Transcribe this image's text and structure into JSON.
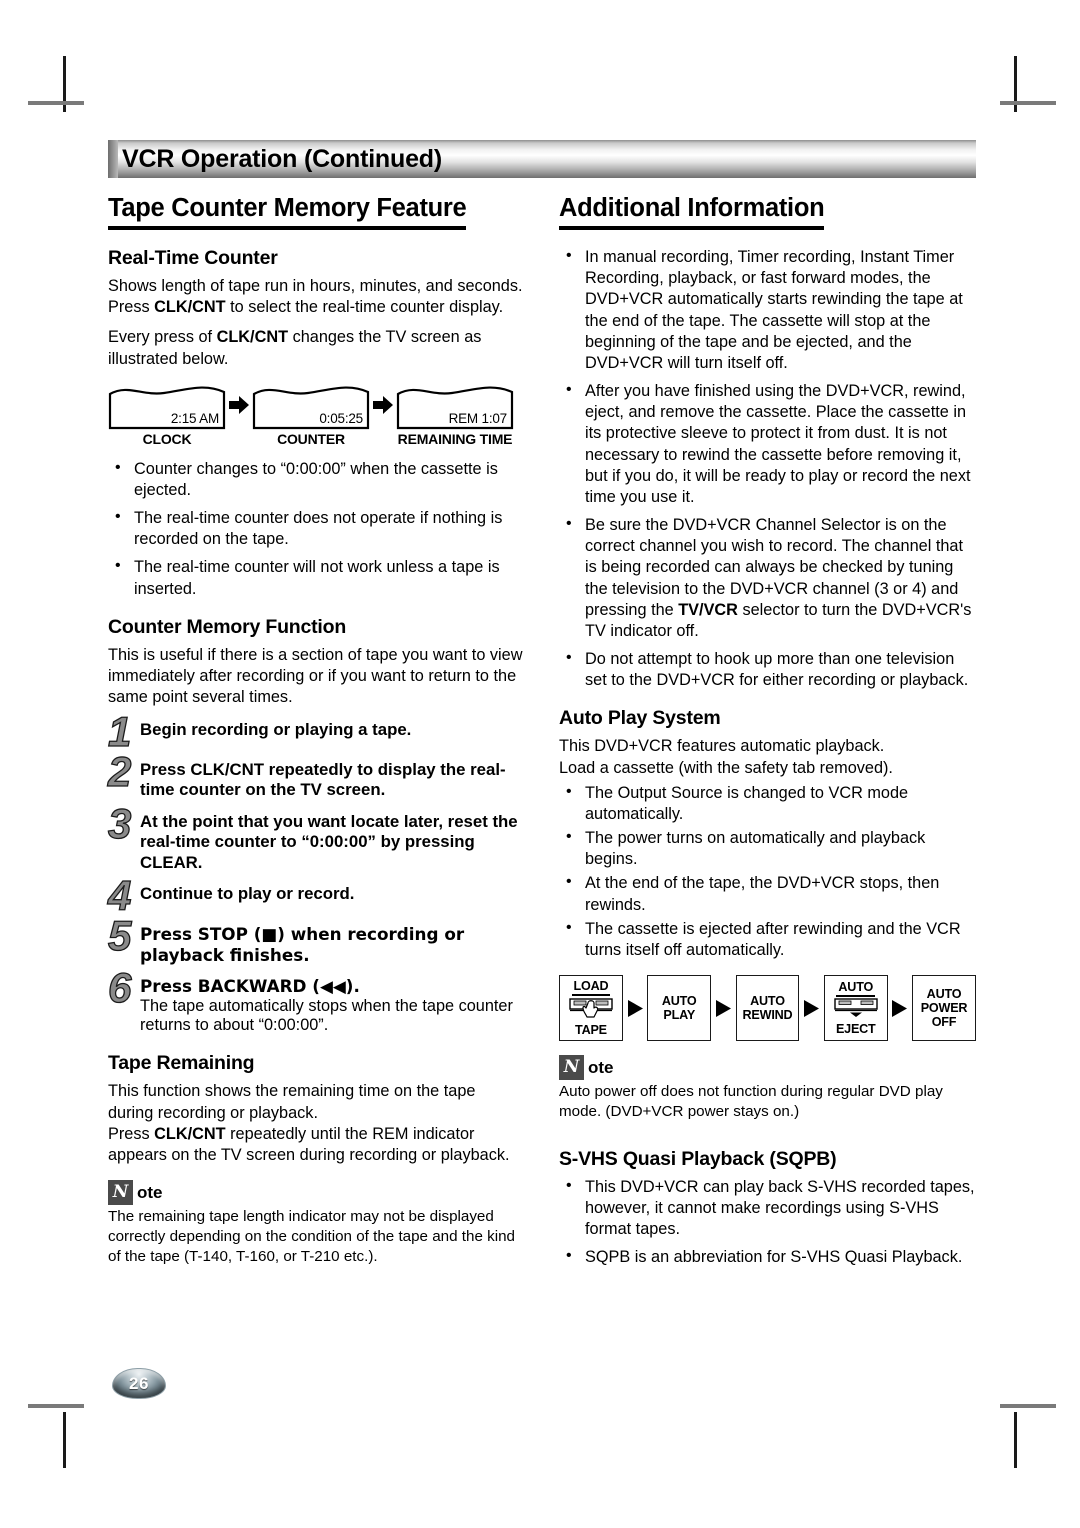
{
  "chapter": {
    "title": "VCR Operation (Continued)"
  },
  "page": {
    "number": "26"
  },
  "left": {
    "section_title": "Tape Counter Memory Feature",
    "realtime": {
      "heading": "Real-Time Counter",
      "para1_a": "Shows length of tape run in hours, minutes, and seconds. Press ",
      "para1_b": "CLK/CNT",
      "para1_c": " to select the real-time counter display.",
      "para2_a": "Every press of ",
      "para2_b": "CLK/CNT",
      "para2_c": " changes the TV screen as illustrated below."
    },
    "screens": [
      {
        "value": "2:15 AM",
        "label": "CLOCK"
      },
      {
        "value": "0:05:25",
        "label": "COUNTER"
      },
      {
        "value": "REM 1:07",
        "label": "REMAINING TIME"
      }
    ],
    "realtime_bullets": [
      "Counter changes to “0:00:00” when the cassette is ejected.",
      "The real-time counter does not operate if nothing is recorded on the tape.",
      "The real-time counter will not work unless a tape is inserted."
    ],
    "memory": {
      "heading": "Counter Memory Function",
      "intro": "This is useful if there is a section of tape you want to view immediately after recording or if you want to return to the same point several times."
    },
    "steps": [
      {
        "num": "1",
        "text": "Begin recording or playing a tape.",
        "extra": ""
      },
      {
        "num": "2",
        "text": "Press CLK/CNT repeatedly to display the real-time counter on the TV screen.",
        "extra": ""
      },
      {
        "num": "3",
        "text": "At the point that you want locate later, reset the real-time counter to “0:00:00” by pressing CLEAR.",
        "extra": ""
      },
      {
        "num": "4",
        "text": "Continue to play or record.",
        "extra": ""
      },
      {
        "num": "5",
        "text": "Press STOP (■) when recording or playback finishes.",
        "extra": ""
      },
      {
        "num": "6",
        "text": "Press BACKWARD (◀◀).",
        "extra": "The tape automatically stops when the tape counter returns to about “0:00:00”."
      }
    ],
    "remaining": {
      "heading": "Tape Remaining",
      "para1": "This function shows the remaining time on the tape during recording or playback.",
      "para2_a": "Press ",
      "para2_b": "CLK/CNT",
      "para2_c": " repeatedly until the REM indicator appears on the TV screen during recording or playback."
    },
    "note": {
      "badge": "N",
      "word": "ote",
      "body": "The remaining tape length indicator may not be displayed correctly depending on the condition of the tape and the kind of the tape (T-140, T-160, or T-210 etc.)."
    }
  },
  "right": {
    "section_title": "Additional Information",
    "bullets": [
      "In manual recording, Timer recording, Instant Timer Recording, playback, or fast forward modes, the DVD+VCR automatically starts rewinding the tape at the end of the tape. The cassette will stop at the beginning of the tape and be ejected, and the DVD+VCR will turn itself off.",
      "After you have finished using the DVD+VCR, rewind, eject, and remove the cassette. Place the cassette in its protective sleeve to protect it from dust. It is not necessary to rewind the cassette before removing it, but if you do, it will be ready to play or record the next time you use it.",
      "Do not attempt to hook up more than one television set to the DVD+VCR for either recording or playback."
    ],
    "bullet_channel": {
      "part_a": "Be sure the DVD+VCR Channel Selector is on the correct channel you wish to record. The channel that is being recorded can always be checked by tuning the television to the DVD+VCR channel (3 or 4) and pressing the ",
      "part_b": "TV/VCR",
      "part_c": " selector to turn the DVD+VCR's TV indicator off."
    },
    "autoplay": {
      "heading": "Auto Play System",
      "para1": "This DVD+VCR features automatic playback.",
      "para2": "Load a cassette (with the safety tab removed).",
      "bullets": [
        "The Output Source is changed to VCR mode automatically.",
        "The power turns on automatically and playback begins.",
        "At the end of the tape, the DVD+VCR stops, then rewinds.",
        "The cassette is ejected after rewinding and the VCR turns itself off automatically."
      ]
    },
    "flow": [
      {
        "top": "LOAD",
        "bottom": "TAPE",
        "icon": "cassette-hand-icon"
      },
      {
        "top": "AUTO",
        "bottom": "PLAY",
        "icon": ""
      },
      {
        "top": "AUTO",
        "bottom": "REWIND",
        "icon": ""
      },
      {
        "top": "AUTO",
        "bottom": "EJECT",
        "icon": "cassette-eject-icon"
      },
      {
        "top": "AUTO",
        "mid": "POWER",
        "bottom": "OFF",
        "icon": ""
      }
    ],
    "note": {
      "badge": "N",
      "word": "ote",
      "body": "Auto power off does not function during regular DVD play mode. (DVD+VCR power stays on.)"
    },
    "sqpb": {
      "heading": "S-VHS Quasi Playback (SQPB)",
      "bullets": [
        "This DVD+VCR can play back S-VHS recorded tapes, however, it cannot make recordings using S-VHS format tapes.",
        "SQPB is an abbreviation for S-VHS Quasi Playback."
      ]
    }
  }
}
